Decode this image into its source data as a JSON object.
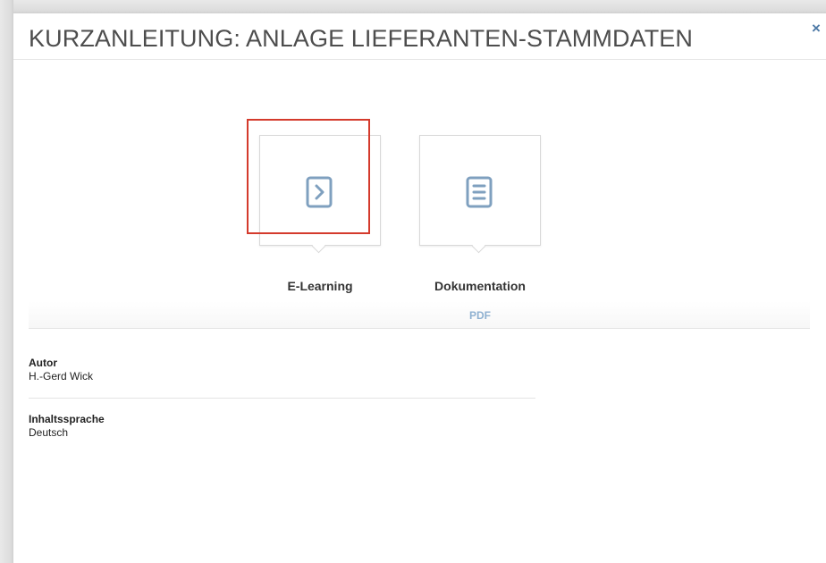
{
  "modal": {
    "title": "KURZANLEITUNG: ANLAGE LIEFERANTEN-STAMMDATEN",
    "close_label": "×"
  },
  "tiles": [
    {
      "label": "E-Learning",
      "icon": "chevron-right-icon",
      "selected": true
    },
    {
      "label": "Dokumentation",
      "icon": "document-icon",
      "format": "PDF",
      "selected": false
    }
  ],
  "info": {
    "autor_label": "Autor",
    "autor_value": "H.-Gerd Wick",
    "sprache_label": "Inhaltssprache",
    "sprache_value": "Deutsch"
  },
  "colors": {
    "highlight": "#d43a2c",
    "icon": "#7fa0bf",
    "link": "#8fb1d1",
    "close": "#4d79a6"
  }
}
